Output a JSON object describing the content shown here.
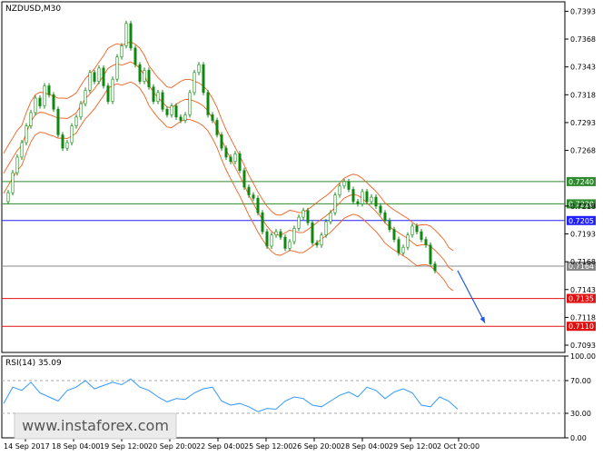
{
  "chart_data": [
    {
      "type": "line",
      "symbol_label": "NZDUSD,M30",
      "ylim": [
        0.70865,
        0.74015
      ],
      "y_ticks": [
        "0.7393",
        "0.7368",
        "0.7343",
        "0.7318",
        "0.7293",
        "0.7268",
        "0.7218",
        "0.7193",
        "0.7168",
        "0.7143",
        "0.7118",
        "0.7093"
      ],
      "x_tick_labels": [
        "14 Sep 2017",
        "18 Sep 04:00",
        "19 Sep 12:00",
        "20 Sep 20:00",
        "22 Sep 04:00",
        "25 Sep 12:00",
        "26 Sep 20:00",
        "28 Sep 04:00",
        "29 Sep 12:00",
        "2 Oct 20:00"
      ],
      "levels": [
        {
          "label": "0.7240",
          "value": 0.724,
          "color": "#2e8b2e"
        },
        {
          "label": "0.7220",
          "value": 0.722,
          "color": "#2e8b2e"
        },
        {
          "label": "0.7205",
          "value": 0.7205,
          "color": "#2222ff"
        },
        {
          "label": "0.7164",
          "value": 0.7164,
          "color": "#888888"
        },
        {
          "label": "0.7135",
          "value": 0.7135,
          "color": "#e01010"
        },
        {
          "label": "0.7110",
          "value": 0.711,
          "color": "#e01010"
        }
      ],
      "price_series": {
        "name": "NZDUSD",
        "x": [
          0,
          5,
          10,
          15,
          20,
          25,
          30,
          35,
          40,
          45,
          50,
          55,
          60,
          65,
          70,
          75,
          80,
          85,
          90,
          95,
          100,
          105,
          110,
          115,
          120,
          125,
          130,
          135,
          140,
          145,
          150,
          155,
          160,
          165,
          170,
          175,
          180,
          185,
          190,
          195,
          200,
          205,
          210,
          215,
          220,
          225,
          230,
          235,
          240,
          245,
          250,
          255,
          260,
          265,
          270,
          275,
          280,
          285,
          290,
          295,
          300,
          305,
          310,
          315,
          320,
          325,
          330,
          335,
          340,
          345,
          350,
          355,
          360,
          365,
          370,
          375,
          380,
          385,
          390,
          395,
          400,
          405,
          410,
          415,
          420,
          425,
          430,
          435,
          440,
          445,
          450,
          455,
          460,
          465,
          470,
          475,
          480,
          485,
          490,
          495,
          500
        ],
        "y": [
          0.7222,
          0.723,
          0.7248,
          0.7262,
          0.7275,
          0.729,
          0.7302,
          0.7315,
          0.7308,
          0.7326,
          0.7318,
          0.7305,
          0.7282,
          0.727,
          0.7275,
          0.729,
          0.7298,
          0.731,
          0.7322,
          0.7338,
          0.733,
          0.7342,
          0.7326,
          0.7312,
          0.7332,
          0.7352,
          0.7362,
          0.7382,
          0.736,
          0.7345,
          0.733,
          0.734,
          0.7325,
          0.7312,
          0.732,
          0.7305,
          0.73,
          0.7308,
          0.7298,
          0.7295,
          0.73,
          0.732,
          0.7338,
          0.7345,
          0.732,
          0.73,
          0.7295,
          0.7282,
          0.727,
          0.7262,
          0.7258,
          0.7265,
          0.725,
          0.7235,
          0.7228,
          0.7225,
          0.7212,
          0.7195,
          0.7182,
          0.7192,
          0.7195,
          0.719,
          0.718,
          0.7186,
          0.7198,
          0.7208,
          0.7214,
          0.7203,
          0.7185,
          0.7183,
          0.7192,
          0.7204,
          0.7212,
          0.7228,
          0.7236,
          0.724,
          0.7233,
          0.7222,
          0.722,
          0.7231,
          0.7222,
          0.7226,
          0.7218,
          0.7212,
          0.7205,
          0.7197,
          0.7188,
          0.7176,
          0.7181,
          0.7192,
          0.72,
          0.7195,
          0.7188,
          0.7183,
          0.7166,
          0.716
        ],
        "color": "#118811"
      },
      "forecast_arrow": {
        "from": [
          500,
          0.716
        ],
        "to": [
          530,
          0.7113
        ],
        "color": "#2255dd"
      }
    },
    {
      "type": "line",
      "indicator_label": "RSI(14) 35.09",
      "ylim": [
        0,
        100
      ],
      "y_ticks": [
        "100.00",
        "70.00",
        "30.00",
        "0.00"
      ],
      "levels": [
        70,
        30
      ],
      "series": [
        {
          "x": [
            0,
            10,
            20,
            30,
            40,
            50,
            60,
            70,
            80,
            90,
            100,
            110,
            120,
            130,
            140,
            150,
            160,
            170,
            180,
            190,
            200,
            210,
            220,
            230,
            240,
            250,
            260,
            270,
            280,
            290,
            300,
            310,
            320,
            330,
            340,
            350,
            360,
            370,
            380,
            390,
            400,
            410,
            420,
            430,
            440,
            450,
            460,
            470,
            480,
            490,
            500
          ],
          "values": [
            42,
            62,
            58,
            68,
            55,
            50,
            45,
            58,
            62,
            70,
            60,
            64,
            68,
            65,
            72,
            62,
            58,
            50,
            44,
            48,
            47,
            55,
            60,
            62,
            45,
            40,
            42,
            38,
            32,
            36,
            35,
            45,
            50,
            48,
            40,
            38,
            45,
            52,
            56,
            50,
            62,
            58,
            48,
            56,
            60,
            55,
            40,
            38,
            50,
            45,
            35
          ]
        }
      ],
      "color": "#3399ff"
    }
  ],
  "watermark": "www.instaforex.com"
}
